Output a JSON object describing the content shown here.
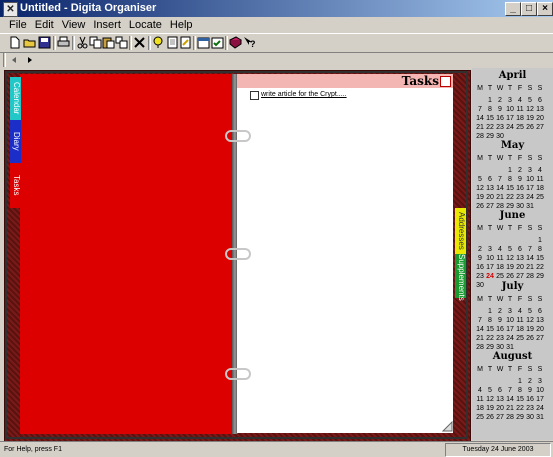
{
  "window": {
    "title": "Untitled - Digita Organiser"
  },
  "menu": [
    "File",
    "Edit",
    "View",
    "Insert",
    "Locate",
    "Help"
  ],
  "toolbar_icons": [
    "new-icon",
    "open-icon",
    "save-icon",
    "print-icon",
    "cut-icon",
    "copy-icon",
    "paste-icon",
    "paste-special-icon",
    "delete-icon",
    "find-icon",
    "page-icon",
    "page-edit-icon",
    "calendar-icon",
    "calendar-check-icon",
    "book-icon",
    "help-icon"
  ],
  "nav": {
    "prev_icon": "arrow-left-icon",
    "next_icon": "arrow-right-icon"
  },
  "organiser": {
    "left_tabs": [
      "Calendar",
      "Diary",
      "Tasks"
    ],
    "right_tabs": [
      "Addresses",
      "Supplements"
    ],
    "page_title": "Tasks",
    "tasks": [
      "write article for the Crypt....."
    ]
  },
  "days_header": [
    "M",
    "T",
    "W",
    "T",
    "F",
    "S",
    "S"
  ],
  "calendars": [
    {
      "name": "April",
      "offset": 1,
      "days": 30
    },
    {
      "name": "May",
      "offset": 3,
      "days": 31
    },
    {
      "name": "June",
      "offset": 6,
      "days": 30,
      "today": 24
    },
    {
      "name": "July",
      "offset": 1,
      "days": 31
    },
    {
      "name": "August",
      "offset": 4,
      "days": 31
    }
  ],
  "status": {
    "help": "For Help, press F1",
    "date": "Tuesday 24 June 2003"
  },
  "colors": {
    "left_page": "#dd0000",
    "tab_calendar": "#22c8c8",
    "tab_diary": "#1c2ec8",
    "tab_tasks": "#dd0000",
    "tab_addresses": "#e8e800",
    "tab_supplements": "#1a9a30"
  }
}
